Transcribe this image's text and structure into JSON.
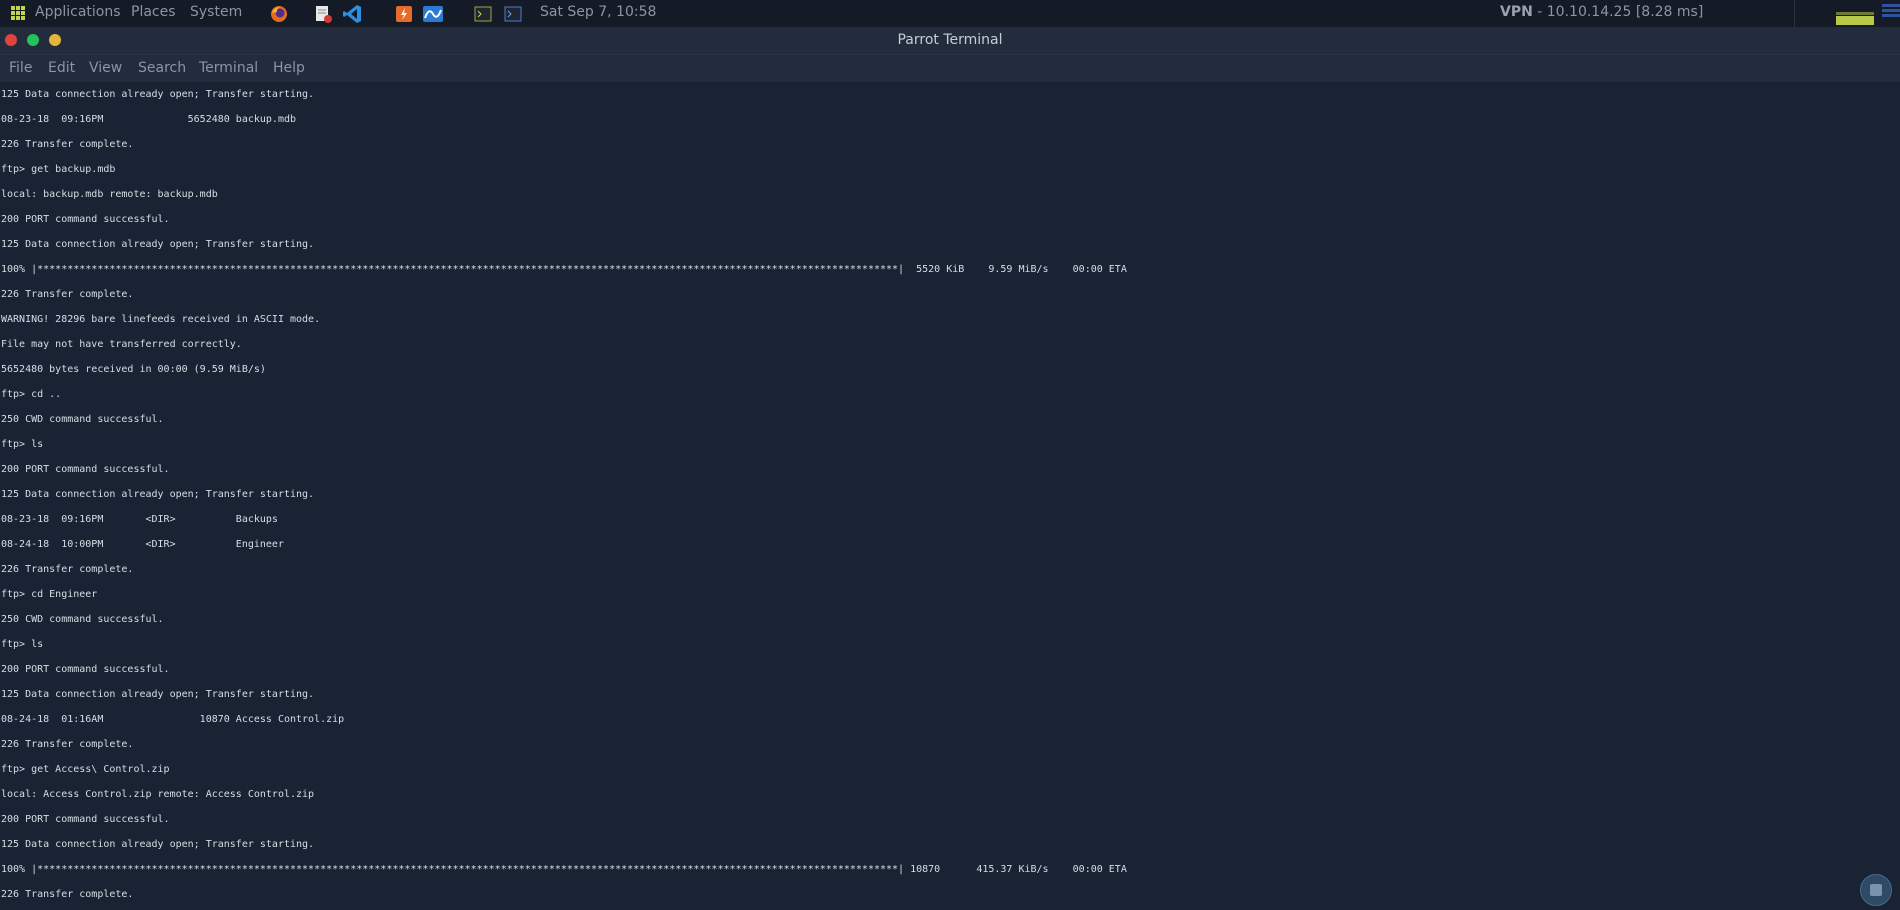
{
  "panel": {
    "menus": [
      "Applications",
      "Places",
      "System"
    ],
    "clock": "Sat Sep 7, 10:58",
    "vpn_label": "VPN",
    "vpn_info": "- 10.10.14.25 [8.28 ms]"
  },
  "window": {
    "title": "Parrot Terminal",
    "menu": [
      "File",
      "Edit",
      "View",
      "Search",
      "Terminal",
      "Help"
    ]
  },
  "terminal": {
    "lines": [
      "125 Data connection already open; Transfer starting.",
      "08-23-18  09:16PM              5652480 backup.mdb",
      "226 Transfer complete.",
      "ftp> get backup.mdb",
      "local: backup.mdb remote: backup.mdb",
      "200 PORT command successful.",
      "125 Data connection already open; Transfer starting.",
      "100% |***********************************************************************************************************************************************|  5520 KiB    9.59 MiB/s    00:00 ETA",
      "226 Transfer complete.",
      "WARNING! 28296 bare linefeeds received in ASCII mode.",
      "File may not have transferred correctly.",
      "5652480 bytes received in 00:00 (9.59 MiB/s)",
      "ftp> cd ..",
      "250 CWD command successful.",
      "ftp> ls",
      "200 PORT command successful.",
      "125 Data connection already open; Transfer starting.",
      "08-23-18  09:16PM       <DIR>          Backups",
      "08-24-18  10:00PM       <DIR>          Engineer",
      "226 Transfer complete.",
      "ftp> cd Engineer",
      "250 CWD command successful.",
      "ftp> ls",
      "200 PORT command successful.",
      "125 Data connection already open; Transfer starting.",
      "08-24-18  01:16AM                10870 Access Control.zip",
      "226 Transfer complete.",
      "ftp> get Access\\ Control.zip",
      "local: Access Control.zip remote: Access Control.zip",
      "200 PORT command successful.",
      "125 Data connection already open; Transfer starting.",
      "100% |***********************************************************************************************************************************************| 10870      415.37 KiB/s    00:00 ETA",
      "226 Transfer complete."
    ]
  },
  "colors": {
    "terminal_bg": "#1a2333",
    "terminal_fg": "#d8dde5",
    "panel_bg": "#141b27",
    "close": "#e0443e",
    "minimize": "#22c35b",
    "maximize": "#e4b53a"
  }
}
